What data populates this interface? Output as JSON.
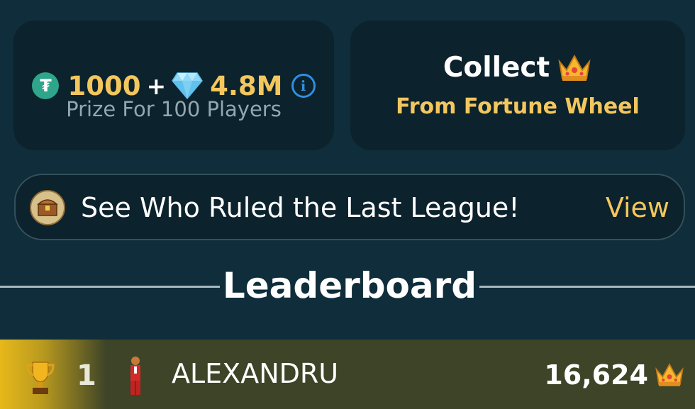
{
  "prize_card": {
    "tether_amount": "1000",
    "plus": "+",
    "diamond_amount": "4.8M",
    "info_symbol": "i",
    "subtitle": "Prize For 100 Players",
    "icons": [
      "tether-icon",
      "diamond-icon",
      "info-icon"
    ]
  },
  "collect_card": {
    "title": "Collect",
    "subtitle": "From Fortune Wheel",
    "icon": "crown-icon"
  },
  "league_banner": {
    "text": "See Who Ruled the Last League!",
    "action_label": "View",
    "icon": "treasure-chest-icon"
  },
  "leaderboard": {
    "title": "Leaderboard",
    "rows": [
      {
        "rank": "1",
        "name": "ALEXANDRU",
        "score": "16,624",
        "rank_icon": "trophy-icon",
        "score_icon": "crown-icon"
      }
    ]
  },
  "colors": {
    "background": "#0f2d3a",
    "card": "#0c222c",
    "gold_text": "#f3c75e",
    "info_blue": "#2f8fe0",
    "row_first_place": "#3d4427"
  }
}
